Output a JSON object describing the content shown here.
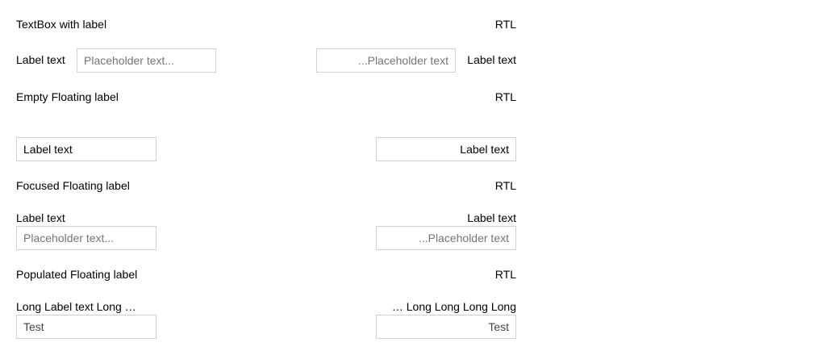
{
  "sections": [
    {
      "title": "TextBox with label",
      "rtl_title": "RTL",
      "ltr_label": "Label text",
      "ltr_placeholder": "Placeholder text...",
      "rtl_label": "Label text",
      "rtl_placeholder": "...Placeholder text"
    },
    {
      "title": "Empty Floating label",
      "rtl_title": "RTL",
      "ltr_field_text": "Label text",
      "rtl_field_text": "Label text"
    },
    {
      "title": "Focused Floating label",
      "rtl_title": "RTL",
      "ltr_label": "Label text",
      "ltr_placeholder": "Placeholder text...",
      "rtl_label": "Label text",
      "rtl_placeholder": "...Placeholder text"
    },
    {
      "title": "Populated Floating label",
      "rtl_title": "RTL",
      "ltr_label": "Long Label text Long …",
      "ltr_value": "Test",
      "rtl_label": "… Long Long Long Long",
      "rtl_value": "Test"
    }
  ]
}
